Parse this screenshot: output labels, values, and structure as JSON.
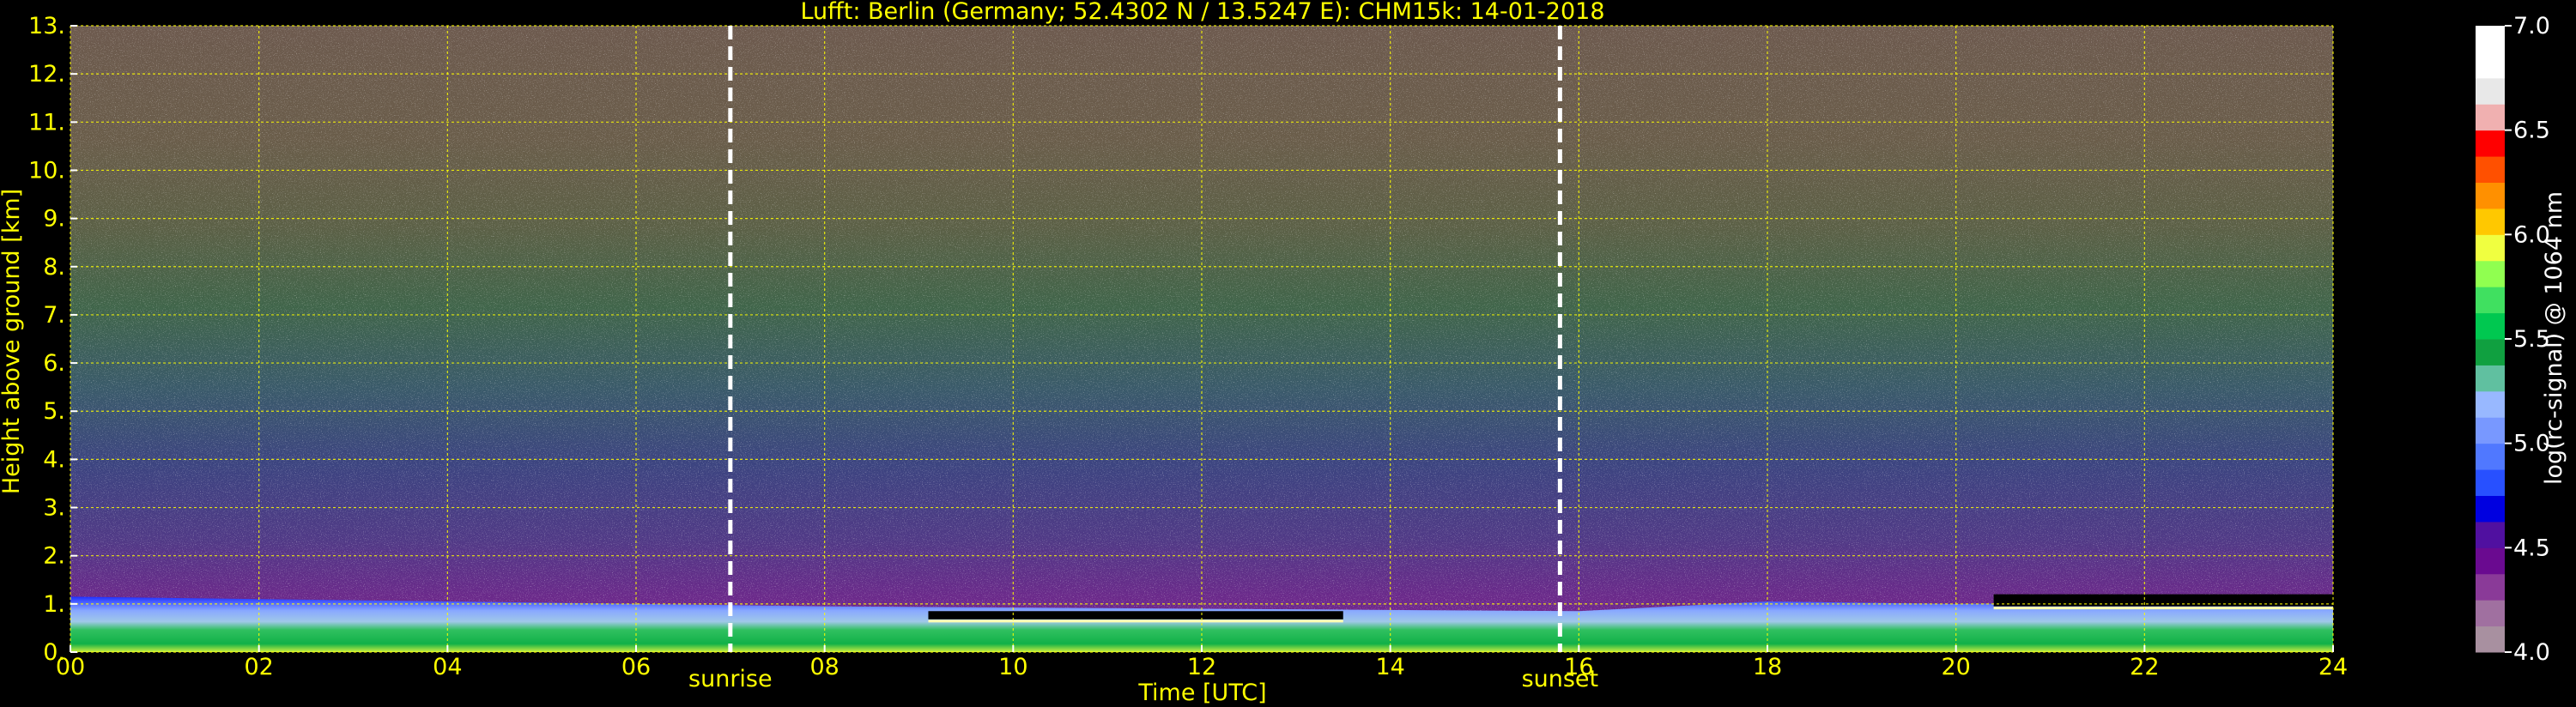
{
  "chart_data": {
    "type": "heatmap",
    "title": "Lufft: Berlin (Germany; 52.4302 N / 13.5247 E):    CHM15k: 14-01-2018",
    "xlabel": "Time [UTC]",
    "ylabel": "Height above ground [km]",
    "xlim": [
      0,
      24
    ],
    "ylim": [
      0,
      13
    ],
    "x_ticks": [
      0,
      2,
      4,
      6,
      8,
      10,
      12,
      14,
      16,
      18,
      20,
      22,
      24
    ],
    "x_tick_labels": [
      "00",
      "02",
      "04",
      "06",
      "08",
      "10",
      "12",
      "14",
      "16",
      "18",
      "20",
      "22",
      "24"
    ],
    "y_ticks": [
      0,
      1,
      2,
      3,
      4,
      5,
      6,
      7,
      8,
      9,
      10,
      11,
      12,
      13
    ],
    "y_tick_labels": [
      "0.",
      "1.",
      "2.",
      "3.",
      "4.",
      "5.",
      "6.",
      "7.",
      "8.",
      "9.",
      "10.",
      "11.",
      "12.",
      "13."
    ],
    "grid": true,
    "grid_color": "#ffff00",
    "markers": [
      {
        "label": "sunrise",
        "x": 7.0
      },
      {
        "label": "sunset",
        "x": 15.8
      }
    ],
    "colorbar": {
      "label": "log(rc-signal) @ 1064 nm",
      "min": 4.0,
      "max": 7.0,
      "ticks": [
        4.0,
        4.5,
        5.0,
        5.5,
        6.0,
        6.5,
        7.0
      ],
      "tick_labels": [
        "4.0",
        "4.5",
        "5.0",
        "5.5",
        "6.0",
        "6.5",
        "7.0"
      ],
      "colors": [
        "#a890a0",
        "#a070a0",
        "#8a3a98",
        "#6a0a90",
        "#5010a0",
        "#0000e0",
        "#2850ff",
        "#5078ff",
        "#7898ff",
        "#98b8ff",
        "#60c0a0",
        "#10a040",
        "#00c850",
        "#40e060",
        "#90ff50",
        "#f0ff40",
        "#ffc800",
        "#ff9000",
        "#ff5000",
        "#ff0000",
        "#f0b0b0",
        "#e8e8e8",
        "#ffffff",
        "#ffffff"
      ]
    },
    "layers": {
      "boundary_layer_top_km": [
        {
          "t": 0,
          "h": 1.15
        },
        {
          "t": 4,
          "h": 1.05
        },
        {
          "t": 8,
          "h": 0.95
        },
        {
          "t": 12,
          "h": 0.9
        },
        {
          "t": 16,
          "h": 0.85
        },
        {
          "t": 18,
          "h": 1.05
        },
        {
          "t": 20,
          "h": 1.0
        },
        {
          "t": 24,
          "h": 1.05
        }
      ],
      "cloud_layers": [
        {
          "start": 9.1,
          "end": 13.5,
          "bottom_km": 0.68,
          "top_km": 0.85
        },
        {
          "start": 20.4,
          "end": 24,
          "bottom_km": 0.95,
          "top_km": 1.2
        }
      ]
    }
  }
}
